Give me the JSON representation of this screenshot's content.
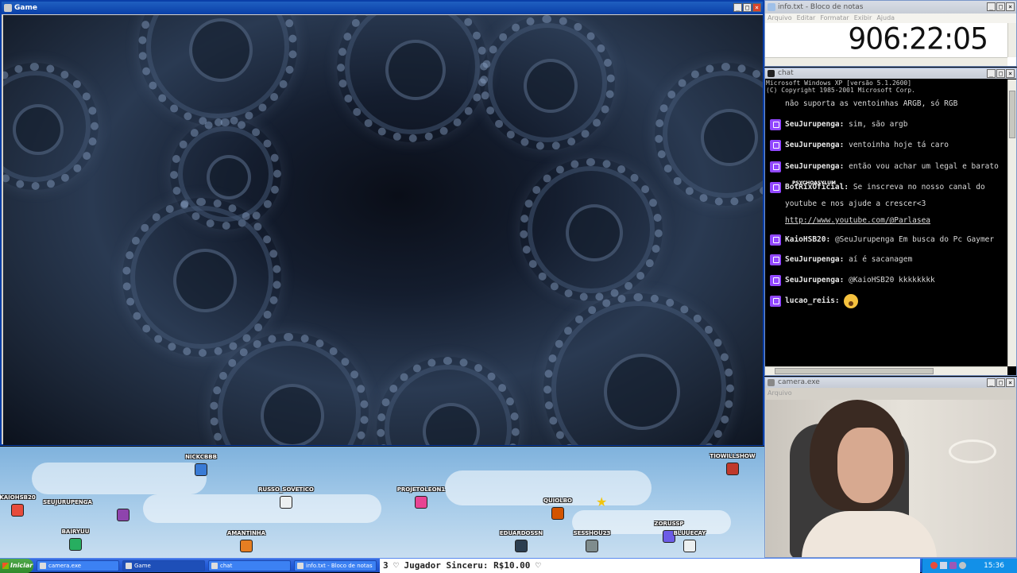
{
  "game_window": {
    "title": "Game"
  },
  "notepad": {
    "title": "info.txt - Bloco de notas",
    "menu": [
      "Arquivo",
      "Editar",
      "Formatar",
      "Exibir",
      "Ajuda"
    ],
    "timer": "906:22:05"
  },
  "chat": {
    "title": "chat",
    "system_lines": [
      "Microsoft Windows XP [versão 5.1.2600]",
      "(C) Copyright 1985-2001 Microsoft Corp."
    ],
    "messages": [
      {
        "user": "",
        "text": "não suporta as ventoinhas ARGB, só RGB"
      },
      {
        "user": "SeuJurupenga:",
        "text": "sim, são argb"
      },
      {
        "user": "SeuJurupenga:",
        "text": "ventoinha hoje tá caro"
      },
      {
        "user": "SeuJurupenga:",
        "text": "então vou achar um legal e barato"
      },
      {
        "user": "BotRixOficial:",
        "text": "Se inscreva no nosso canal do youtube e nos ajude a crescer<3",
        "link": "http://www.youtube.com/@Parlasea"
      },
      {
        "user": "KaioHSB20:",
        "text": "@SeuJurupenga Em busca do Pc Gaymer"
      },
      {
        "user": "SeuJurupenga:",
        "text": "aí é sacanagem"
      },
      {
        "user": "SeuJurupenga:",
        "text": "@KaioHSB20 kkkkkkkk"
      },
      {
        "user": "lucao_reiis:",
        "text": "",
        "emoji": "astonished-emoji"
      }
    ],
    "overlay_name": "PSYCHOASYLUM"
  },
  "camera": {
    "title": "camera.exe",
    "menu": [
      "Arquivo"
    ]
  },
  "strip": {
    "avatars": [
      {
        "name": "NICKCBBB",
        "color": "#3a7bd5"
      },
      {
        "name": "TIOWILLSHOW",
        "color": "#c0392b"
      },
      {
        "name": "KAIOHSB20",
        "color": "#e74c3c"
      },
      {
        "name": "SEUJURUPENGA",
        "color": "#8e44ad"
      },
      {
        "name": "RUSSO_SOVETICO",
        "color": "#ecf0f1"
      },
      {
        "name": "PROJETOLEON1",
        "color": "#e84393"
      },
      {
        "name": "QUIOLBO",
        "color": "#d35400"
      },
      {
        "name": "AMANTINHA",
        "color": "#e67e22"
      },
      {
        "name": "EDUARDOSSN",
        "color": "#2c3e50"
      },
      {
        "name": "SESSHOU23",
        "color": "#7f8c8d"
      },
      {
        "name": "ZORUSSP",
        "color": "#6c5ce7"
      },
      {
        "name": "BLUUECAY",
        "color": "#ecf0f1"
      },
      {
        "name": "BAIRYUU",
        "color": "#27ae60"
      }
    ]
  },
  "taskbar": {
    "start": "Iniciar",
    "tasks": [
      "camera.exe",
      "Game",
      "chat",
      "info.txt - Bloco de notas"
    ],
    "ticker": "3 ♡ Jugador Sinceru: R$10.00 ♡",
    "clock": "15:36"
  }
}
